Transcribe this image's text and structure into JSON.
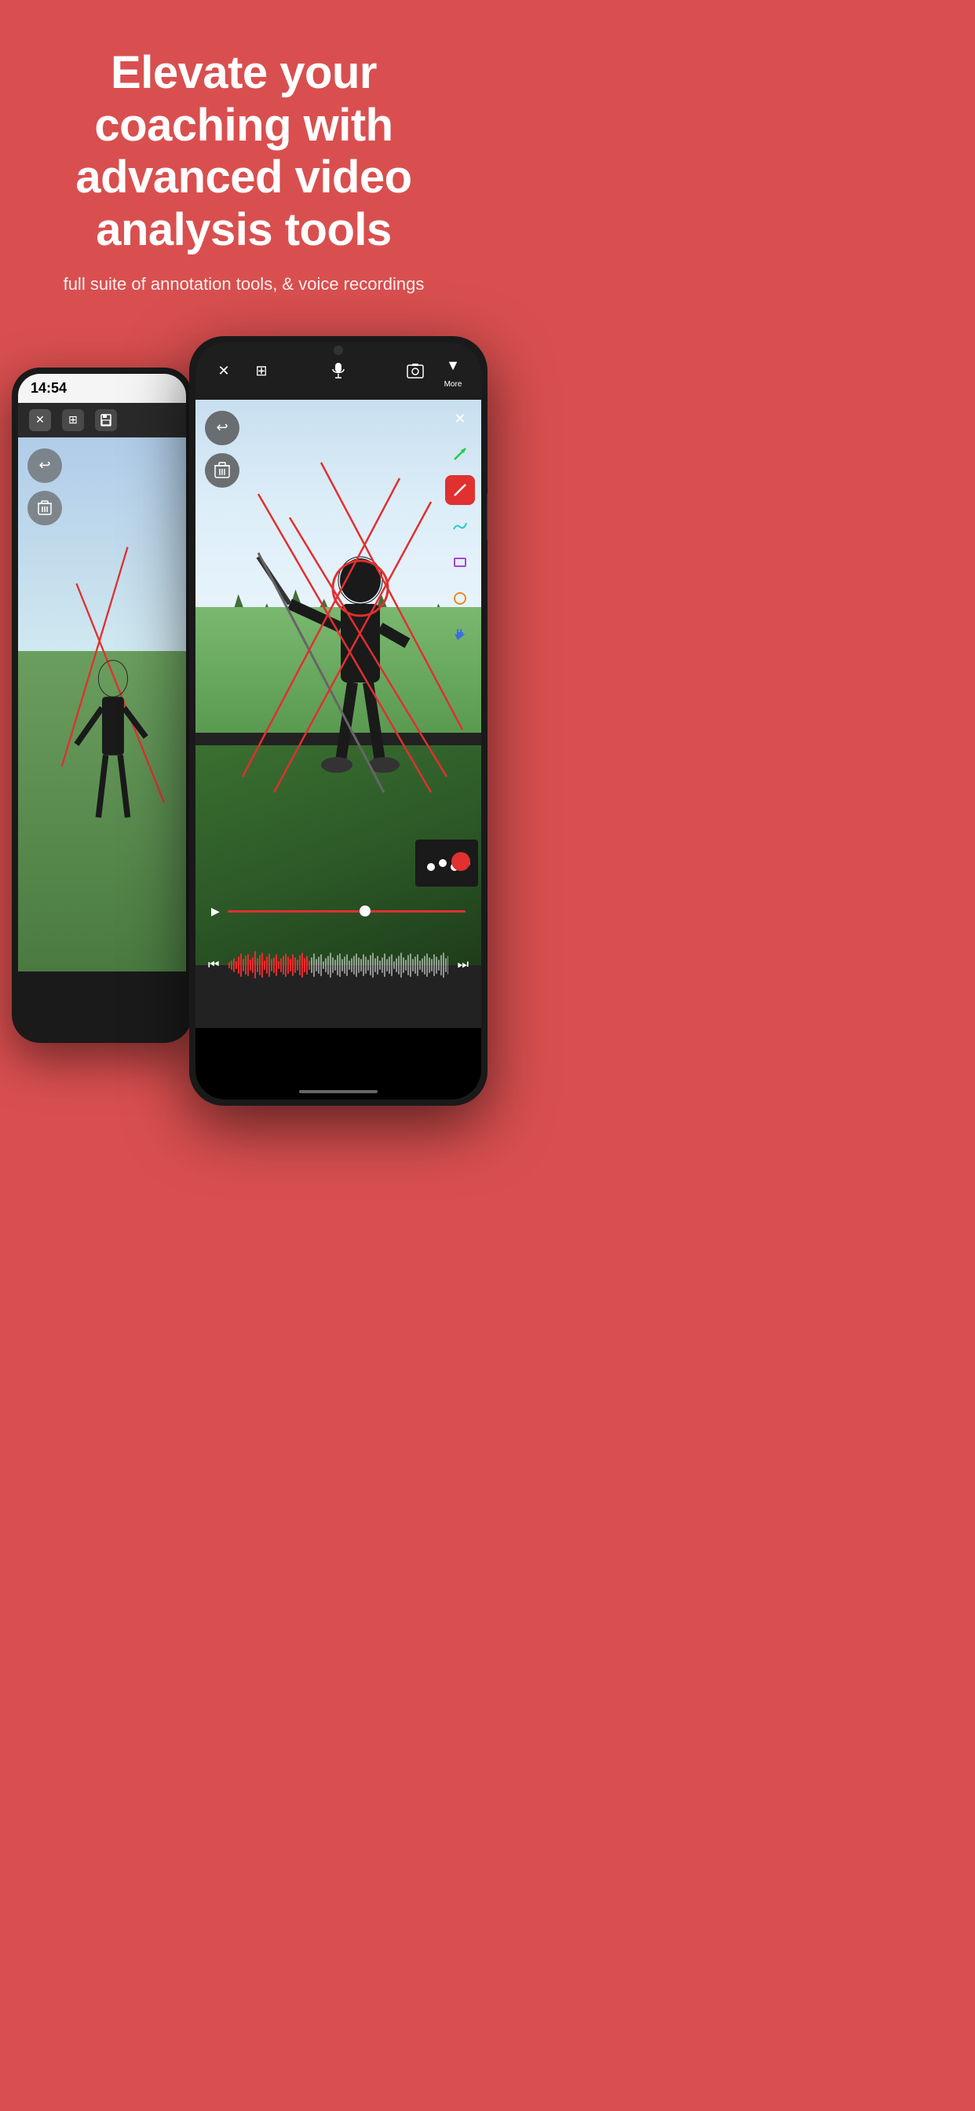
{
  "hero": {
    "background_color": "#d94f4f",
    "title": "Elevate your coaching with advanced video analysis tools",
    "subtitle": "full suite of annotation tools, & voice recordings"
  },
  "phones": {
    "back_phone": {
      "status_time": "14:54",
      "toolbar_items": [
        "close",
        "split",
        "save"
      ],
      "video_description": "golfer swing side view"
    },
    "front_phone": {
      "toolbar_items": [
        "close",
        "split",
        "mic",
        "screenshot",
        "more"
      ],
      "more_label": "More",
      "annotation_tools": [
        "arrow",
        "line",
        "draw",
        "rectangle",
        "circle",
        "move"
      ],
      "video_description": "golfer swing front view with red annotations"
    }
  },
  "icons": {
    "close": "✕",
    "split": "⊞",
    "save": "💾",
    "mic": "🎙",
    "screenshot": "📷",
    "more_arrow": "▼",
    "undo": "↩",
    "delete": "🗑",
    "play": "▶",
    "skip_back": "⏮",
    "skip_forward": "⏭",
    "arrow_tool": "↗",
    "draw_tool": "〜",
    "rect_tool": "▭",
    "circle_tool": "○",
    "move_tool": "✥"
  }
}
